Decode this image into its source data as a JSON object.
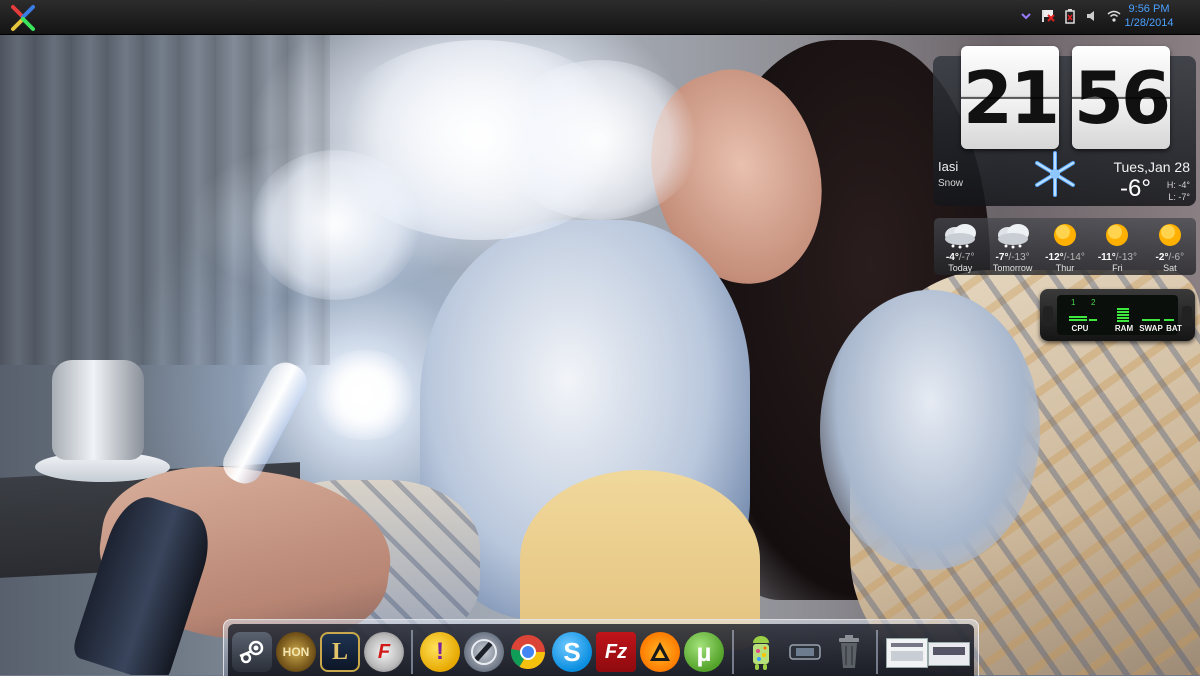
{
  "taskbar": {
    "time": "9:56 PM",
    "date": "1/28/2014",
    "tray_icons": [
      "chevron-down-icon",
      "flag-icon",
      "battery-icon",
      "volume-icon",
      "wifi-icon"
    ]
  },
  "clock_widget": {
    "hours": "21",
    "minutes": "56"
  },
  "weather": {
    "city": "Iasi",
    "condition": "Snow",
    "date": "Tues,Jan 28",
    "temp": "-6°",
    "high_label": "H:",
    "high": "-4°",
    "low_label": "L:",
    "low": "-7°",
    "forecast": [
      {
        "day": "Today",
        "hi": "-4°",
        "lo": "/-7°",
        "icon": "cloud-snow-icon"
      },
      {
        "day": "Tomorrow",
        "hi": "-7°",
        "lo": "/-13°",
        "icon": "cloud-snow-icon"
      },
      {
        "day": "Thur",
        "hi": "-12°",
        "lo": "/-14°",
        "icon": "sun-icon"
      },
      {
        "day": "Fri",
        "hi": "-11°",
        "lo": "/-13°",
        "icon": "sun-icon"
      },
      {
        "day": "Sat",
        "hi": "-2°",
        "lo": "/-6°",
        "icon": "sun-icon"
      }
    ]
  },
  "system_meter": {
    "core1": "1",
    "core2": "2",
    "labels": [
      "CPU",
      "RAM",
      "SWAP",
      "BAT"
    ]
  },
  "dock": {
    "items": [
      {
        "name": "steam",
        "icon": "steam-icon"
      },
      {
        "name": "hon",
        "icon": "hon-icon",
        "text": "HON"
      },
      {
        "name": "league-of-legends",
        "icon": "league-of-legends-icon",
        "text": "L"
      },
      {
        "name": "crossfire",
        "icon": "crossfire-icon",
        "text": "F"
      },
      {
        "name": "yahoo-messenger",
        "icon": "yahoo-messenger-icon",
        "text": "!"
      },
      {
        "name": "dota2",
        "icon": "dota2-icon"
      },
      {
        "name": "chrome",
        "icon": "chrome-icon"
      },
      {
        "name": "skype",
        "icon": "skype-icon",
        "text": "S"
      },
      {
        "name": "filezilla",
        "icon": "filezilla-icon",
        "text": "Fz"
      },
      {
        "name": "aimp",
        "icon": "aimp-icon"
      },
      {
        "name": "utorrent",
        "icon": "utorrent-icon",
        "text": "µ"
      },
      {
        "name": "bluestacks",
        "icon": "android-icon"
      },
      {
        "name": "controller",
        "icon": "gamepad-icon"
      },
      {
        "name": "recycle-bin",
        "icon": "trash-icon"
      },
      {
        "name": "window-preview",
        "icon": "window-thumbnails-icon"
      }
    ]
  }
}
